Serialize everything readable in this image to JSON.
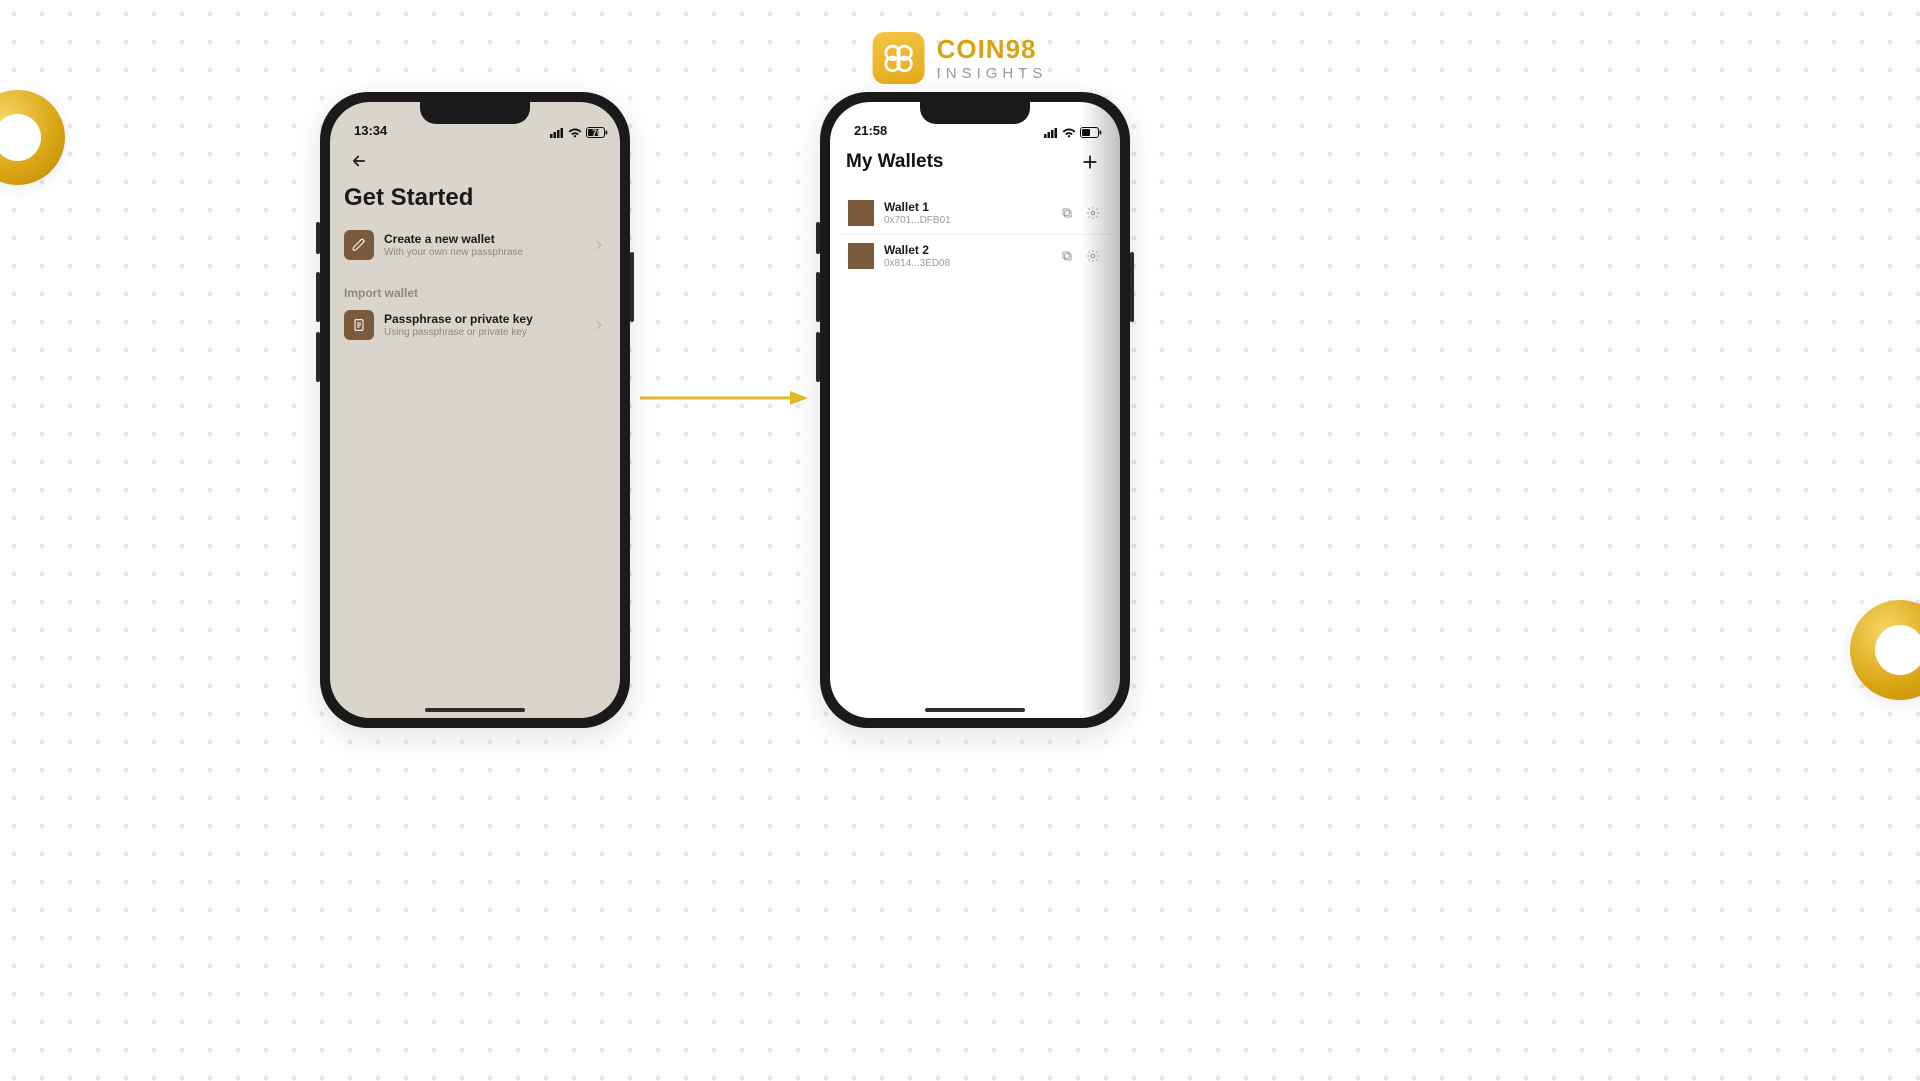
{
  "brand": {
    "name": "COIN98",
    "subtitle": "INSIGHTS"
  },
  "colors": {
    "accent": "#d9a412",
    "option_icon_bg": "#7a5a3a"
  },
  "left_phone": {
    "status": {
      "time": "13:34",
      "battery": "70"
    },
    "title": "Get Started",
    "create_option": {
      "title": "Create a new wallet",
      "subtitle": "With your own new passphrase"
    },
    "import_section_label": "Import wallet",
    "import_option": {
      "title": "Passphrase or private key",
      "subtitle": "Using passphrase or private key"
    }
  },
  "right_phone": {
    "status": {
      "time": "21:58",
      "battery": "45"
    },
    "title": "My Wallets",
    "wallets": [
      {
        "name": "Wallet 1",
        "address": "0x701...DFB01"
      },
      {
        "name": "Wallet 2",
        "address": "0x814...3ED08"
      }
    ]
  }
}
